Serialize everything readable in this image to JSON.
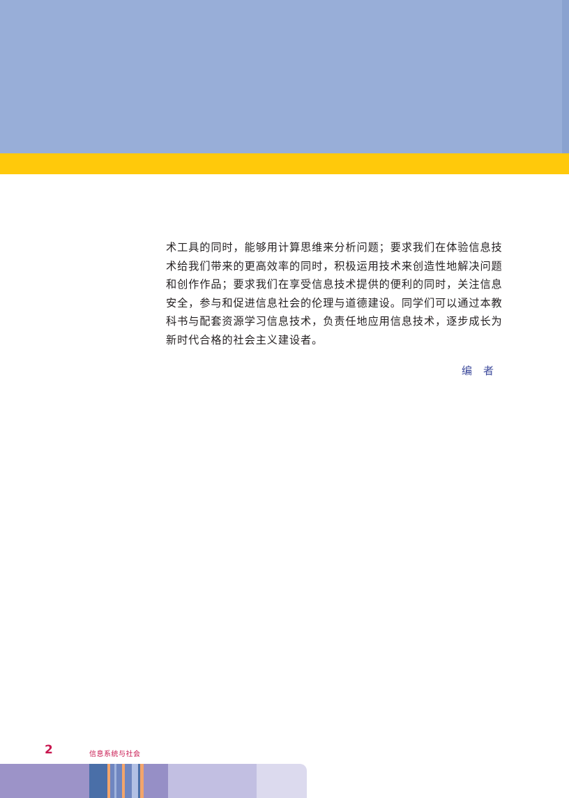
{
  "body": {
    "lines": [
      "术工具的同时，能够用计算思维来分析问题；要求我们在体验信息技",
      "术给我们带来的更高效率的同时，积极运用技术来创造性地解决问题",
      "和创作作品；要求我们在享受信息技术提供的便利的同时，关注信息",
      "安全，参与和促进信息社会的伦理与道德建设。同学们可以通过本教",
      "科书与配套资源学习信息技术，负责任地应用信息技术，逐步成长为",
      "新时代合格的社会主义建设者。"
    ],
    "signature": "编者"
  },
  "footer": {
    "page_number": "2",
    "running_title": "信息系统与社会"
  },
  "colors": {
    "header_blue": "#98aed8",
    "accent_yellow": "#ffc90b",
    "footer_magenta": "#c8174f",
    "signature_blue": "#3e4b9c"
  }
}
